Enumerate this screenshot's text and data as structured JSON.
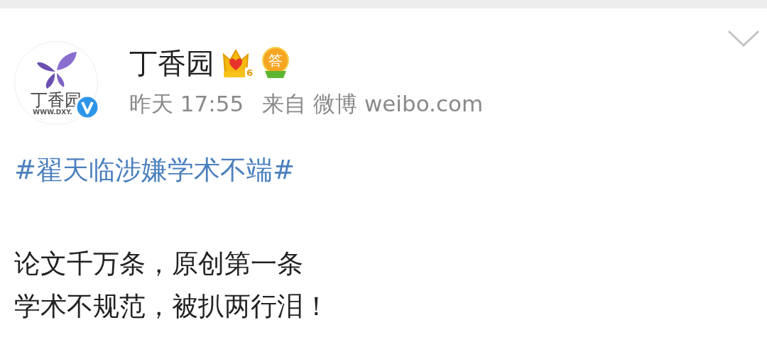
{
  "post": {
    "author": {
      "name": "丁香园",
      "avatar_text": "丁香园",
      "avatar_url": "WWW.DXY.",
      "verified": true,
      "badges": [
        {
          "kind": "crown",
          "text": "6"
        },
        {
          "kind": "answer",
          "text": "答"
        }
      ]
    },
    "time": "昨天 17:55",
    "source": "来自 微博 weibo.com",
    "topic": "#翟天临涉嫌学术不端#",
    "lines": [
      "论文千万条，原创第一条",
      "学术不规范，被扒两行泪！"
    ]
  }
}
